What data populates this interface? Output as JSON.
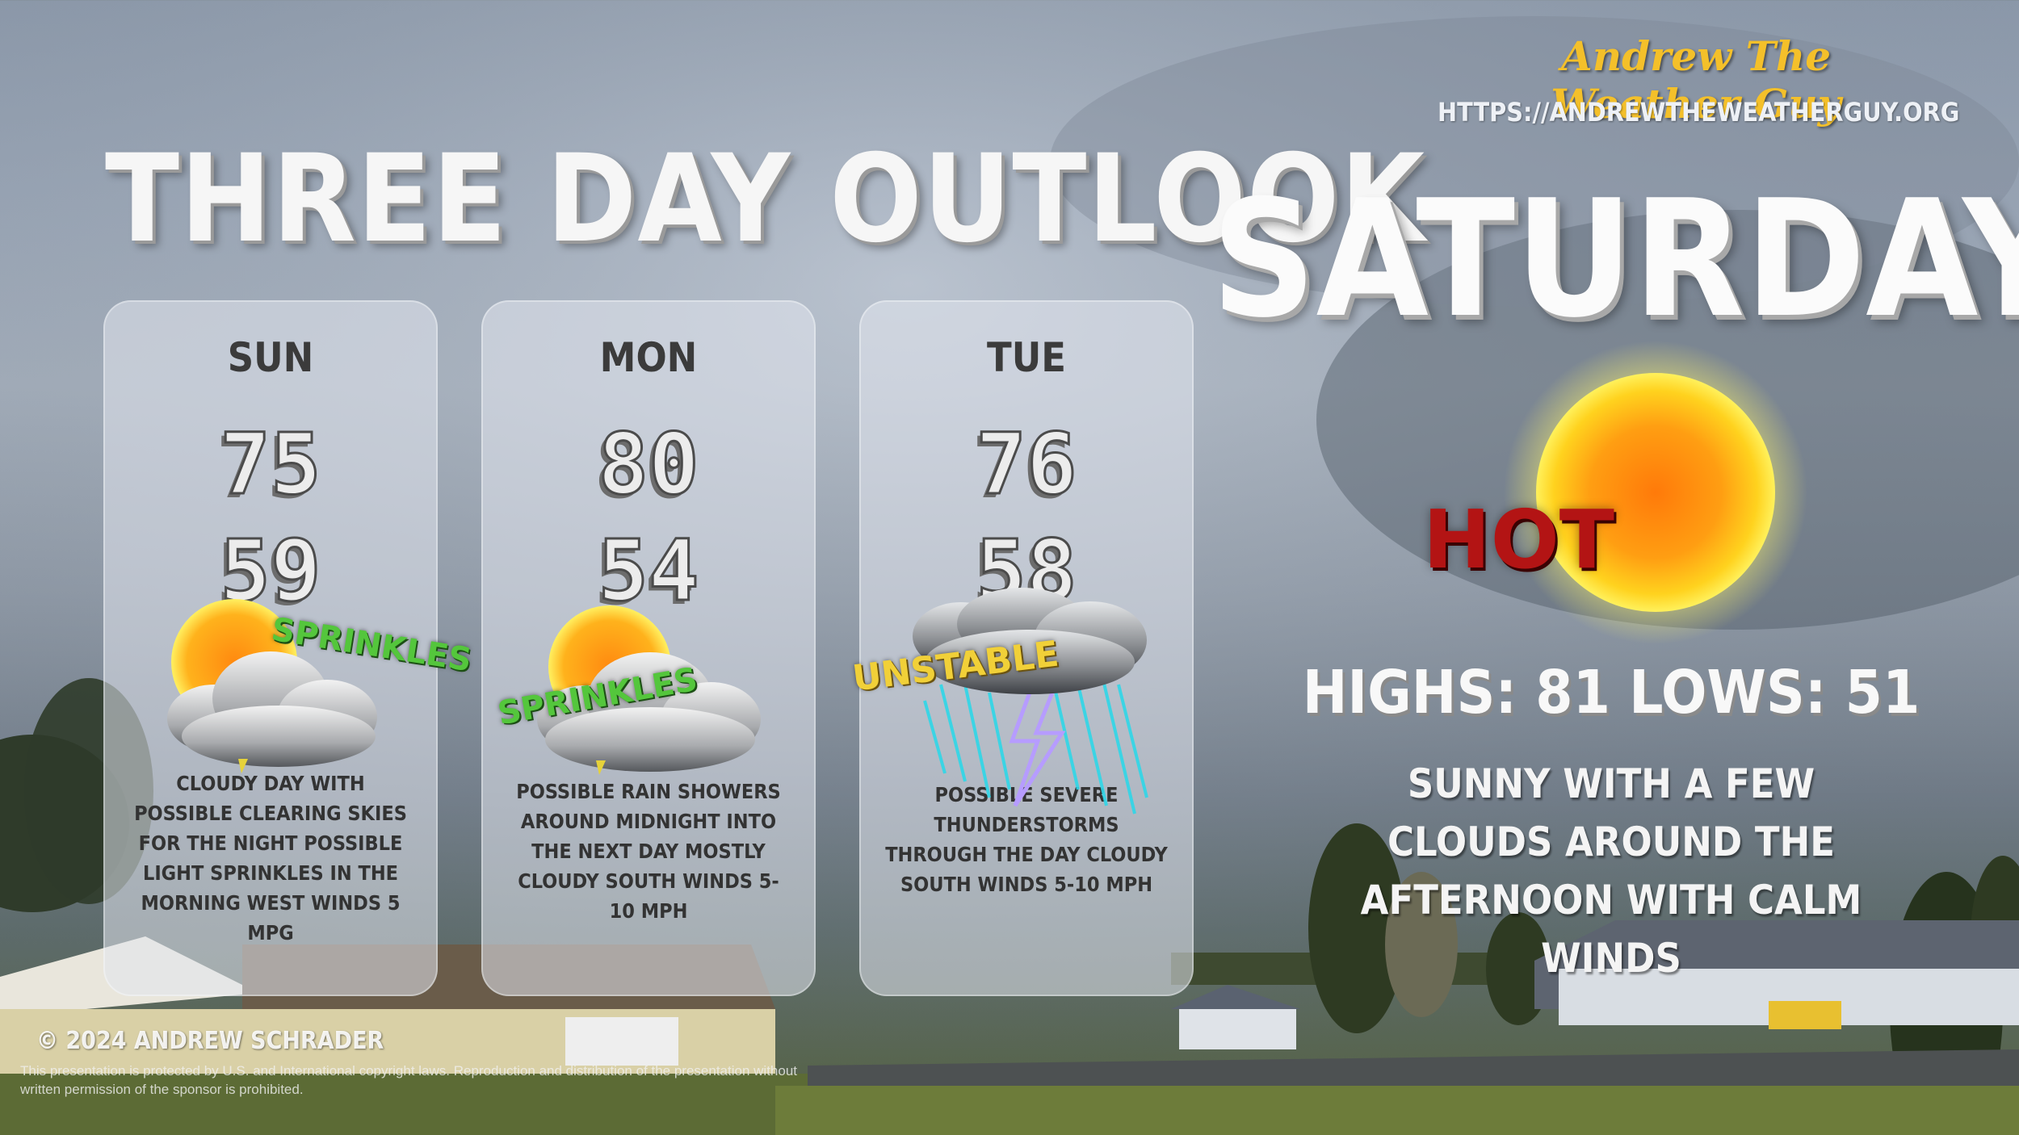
{
  "brand": {
    "name": "Andrew The Weather Guy",
    "url": "HTTPS://ANDREWTHEWEATHERGUY.ORG"
  },
  "title": "THREE DAY OUTLOOK",
  "featured_day": {
    "name": "SATURDAY",
    "condition_word": "HOT",
    "icon": "sun-icon",
    "highs_lows": "HIGHS: 81 LOWS: 51",
    "summary": "SUNNY WITH A FEW CLOUDS AROUND THE AFTERNOON WITH CALM WINDS"
  },
  "days": [
    {
      "day": "SUN",
      "high": "75",
      "low": "59",
      "icon": "partly-cloudy-sprinkles-icon",
      "tag": "SPRINKLES",
      "description": "CLOUDY DAY WITH POSSIBLE CLEARING SKIES FOR THE NIGHT POSSIBLE LIGHT SPRINKLES IN THE MORNING WEST WINDS 5 MPG"
    },
    {
      "day": "MON",
      "high": "80",
      "low": "54",
      "icon": "partly-cloudy-sprinkles-icon",
      "tag": "SPRINKLES",
      "description": "POSSIBLE RAIN SHOWERS AROUND MIDNIGHT INTO THE NEXT DAY MOSTLY CLOUDY SOUTH WINDS 5-10 MPH"
    },
    {
      "day": "TUE",
      "high": "76",
      "low": "58",
      "icon": "thunderstorm-icon",
      "tag": "UNSTABLE",
      "description": "POSSIBLE SEVERE THUNDERSTORMS THROUGH THE DAY CLOUDY SOUTH WINDS 5-10 MPH"
    }
  ],
  "footer": {
    "copyright": "© 2024 ANDREW SCHRADER",
    "legal": "This presentation is protected by U.S. and International copyright laws. Reproduction and distribution of the presentation without written permission of the sponsor is prohibited."
  },
  "colors": {
    "brand_gold": "#f4c02a",
    "sprinkles_green": "#54c63c",
    "unstable_yellow": "#f1d038",
    "hot_red": "#b31414",
    "lightning_purple": "#b69cff",
    "rain_cyan": "#2fd7e8"
  }
}
